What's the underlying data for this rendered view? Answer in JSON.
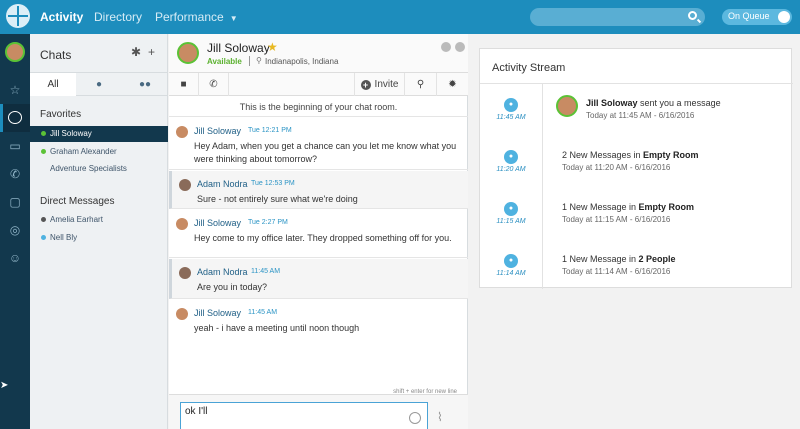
{
  "topbar": {
    "nav": [
      "Activity",
      "Directory",
      "Performance"
    ],
    "toggle_label": "On Queue",
    "search_icon": "search-icon"
  },
  "rail": {
    "icons": [
      "favorites-star-icon",
      "chat-bubble-icon",
      "video-icon",
      "phone-icon",
      "inbox-icon",
      "target-icon",
      "user-status-icon"
    ]
  },
  "chats": {
    "title": "Chats",
    "tabs": [
      "All",
      "",
      ""
    ],
    "favorites_label": "Favorites",
    "favorites": [
      {
        "name": "Jill Soloway",
        "status_color": "#5bc236",
        "active": true
      },
      {
        "name": "Graham Alexander",
        "status_color": "#5bc236",
        "active": false
      },
      {
        "name": "Adventure Specialists",
        "status_color": "",
        "active": false
      }
    ],
    "direct_label": "Direct Messages",
    "direct": [
      {
        "name": "Amelia Earhart",
        "status_color": "#555555"
      },
      {
        "name": "Nell Bly",
        "status_color": "#4fb2e0"
      }
    ]
  },
  "conversation": {
    "name": "Jill Soloway",
    "status": "Available",
    "location": "Indianapolis, Indiana",
    "invite_label": "Invite",
    "begin_text": "This is the beginning of your chat room.",
    "messages": [
      {
        "author": "Jill Soloway",
        "time": "Tue 12:21 PM",
        "text": "Hey Adam, when you get a chance can you let me know what you were thinking about tomorrow?"
      },
      {
        "author": "Adam Nodra",
        "time": "Tue 12:53 PM",
        "text": "Sure -  not entirely sure what we're doing"
      },
      {
        "author": "Jill Soloway",
        "time": "Tue 2:27 PM",
        "text": "Hey come to my office later. They dropped something off for you."
      },
      {
        "author": "Adam Nodra",
        "time": "11:45 AM",
        "text": "Are you in today?"
      },
      {
        "author": "Jill Soloway",
        "time": "11:45 AM",
        "text": "yeah - i have a meeting until noon though"
      }
    ],
    "hint": "shift + enter for new line",
    "draft": "ok I'll"
  },
  "activity": {
    "title": "Activity Stream",
    "items": [
      {
        "time": "11:45 AM",
        "text_pre": "Jill Soloway",
        "text_mid": " sent you a message",
        "text_bold": "",
        "sub": "Today at 11:45 AM - 6/16/2016",
        "has_avatar": true
      },
      {
        "time": "11:20 AM",
        "text_pre": "2 New Messages in ",
        "text_mid": "",
        "text_bold": "Empty Room",
        "sub": "Today at 11:20 AM - 6/16/2016",
        "has_avatar": false
      },
      {
        "time": "11:15 AM",
        "text_pre": "1 New Message in ",
        "text_mid": "",
        "text_bold": "Empty Room",
        "sub": "Today at 11:15 AM - 6/16/2016",
        "has_avatar": false
      },
      {
        "time": "11:14 AM",
        "text_pre": "1 New Message in ",
        "text_mid": "",
        "text_bold": "2 People",
        "sub": "Today at 11:14 AM - 6/16/2016",
        "has_avatar": false
      }
    ]
  }
}
